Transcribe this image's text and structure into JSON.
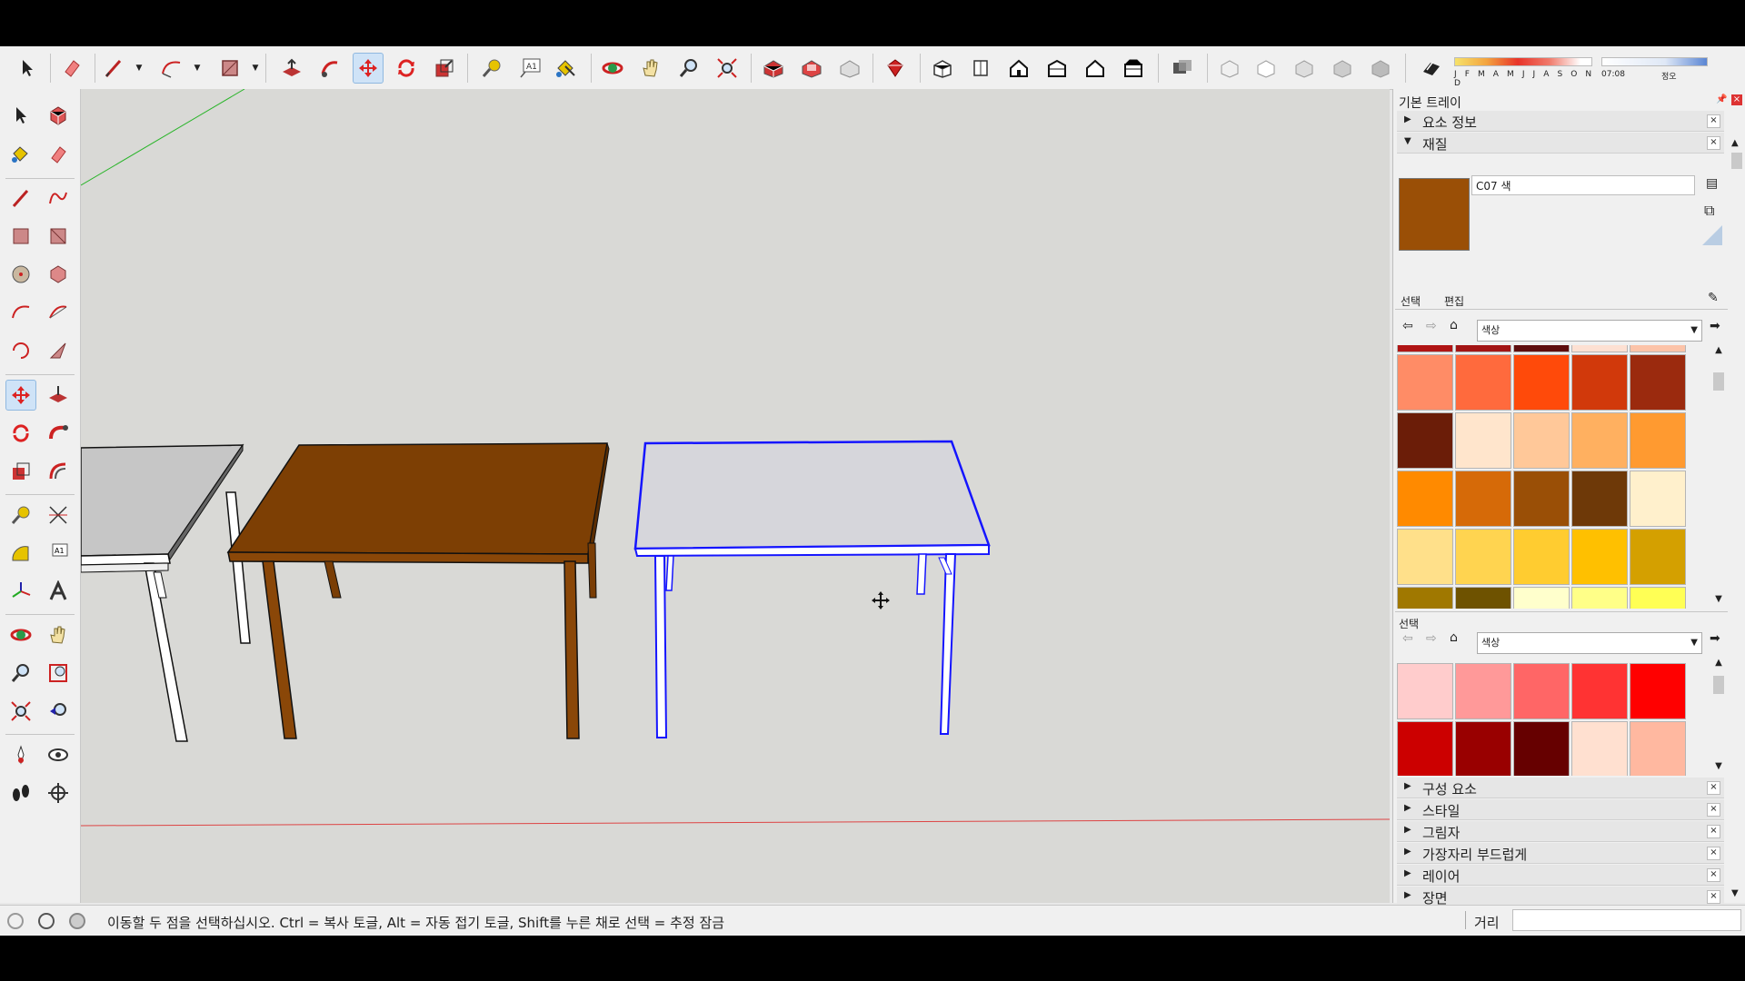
{
  "tray": {
    "title": "기본 트레이",
    "entity_info": "요소 정보",
    "materials": "재질",
    "material_name": "C07 색",
    "tab_select": "선택",
    "tab_edit": "편집",
    "collection": "색상",
    "secondary_select": "선택",
    "secondary_collection": "색상",
    "panels": [
      "구성 요소",
      "스타일",
      "그림자",
      "가장자리 부드럽게",
      "레이어",
      "장면"
    ],
    "main_swatch_color": "#9a4f06"
  },
  "swatches_top": [
    "#b01414",
    "#a21414",
    "#5e0d0d",
    "#fde0d2",
    "#fcc3a8",
    "#ff8c66",
    "#ff6a3d",
    "#ff4a0a",
    "#d1390b",
    "#9b2a0e",
    "#6b1d08",
    "#ffe5cc",
    "#ffc899",
    "#ffb060",
    "#ff9a30",
    "#ff8a00",
    "#d66a08",
    "#9a4f06",
    "#6e3908",
    "#fff0cc",
    "#ffe08a",
    "#ffd450",
    "#ffcc30",
    "#ffc000",
    "#d4a000",
    "#a07800",
    "#6e5200",
    "#ffffcc",
    "#ffff88",
    "#ffff55",
    "#ffff30",
    "#ffff00",
    "#d4d400",
    "#a0a000",
    "#6e6e00"
  ],
  "swatches_bottom": [
    "#ffcccc",
    "#ff9999",
    "#ff6666",
    "#ff3333",
    "#ff0000",
    "#cc0000",
    "#990000",
    "#660000",
    "#ffe0d0",
    "#ffb8a0"
  ],
  "shadow": {
    "months": "J F M A M J J A S O N D",
    "time_start": "07:08",
    "time_noon": "정오"
  },
  "status": {
    "message": "이동할 두 점을 선택하십시오. Ctrl = 복사 토글, Alt = 자동 접기 토글, Shift를 누른 채로 선택 = 추정 잠금",
    "measure_label": "거리",
    "measure_value": ""
  }
}
